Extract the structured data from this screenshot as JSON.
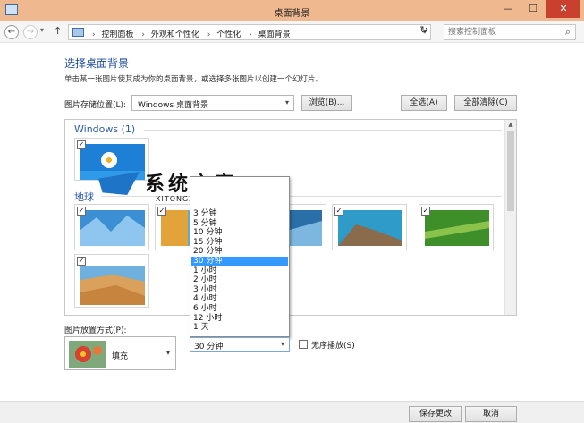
{
  "window": {
    "title": "桌面背景"
  },
  "nav": {
    "breadcrumbs": [
      "控制面板",
      "外观和个性化",
      "个性化",
      "桌面背景"
    ],
    "search_placeholder": "搜索控制面板"
  },
  "content": {
    "heading": "选择桌面背景",
    "description": "单击某一张图片使其成为你的桌面背景，或选择多张图片以创建一个幻灯片。",
    "location_label": "图片存储位置(L):",
    "location_value": "Windows 桌面背景",
    "browse_label": "浏览(B)...",
    "select_all_label": "全选(A)",
    "clear_all_label": "全部清除(C)"
  },
  "groups": [
    {
      "name": "Windows (1)"
    },
    {
      "name": "地球"
    }
  ],
  "watermark": {
    "cn": "系统之家",
    "en": "XITONGZHIJIA.NET"
  },
  "interval_options": [
    "3 分钟",
    "5 分钟",
    "10 分钟",
    "15 分钟",
    "20 分钟",
    "30 分钟",
    "1 小时",
    "2 小时",
    "3 小时",
    "4 小时",
    "6 小时",
    "12 小时",
    "1 天"
  ],
  "interval_selected_index": 5,
  "bottom": {
    "position_label": "图片放置方式(P):",
    "position_value": "填充",
    "interval_value": "30 分钟",
    "shuffle_label": "无序播放(S)",
    "save_label": "保存更改",
    "cancel_label": "取消"
  }
}
